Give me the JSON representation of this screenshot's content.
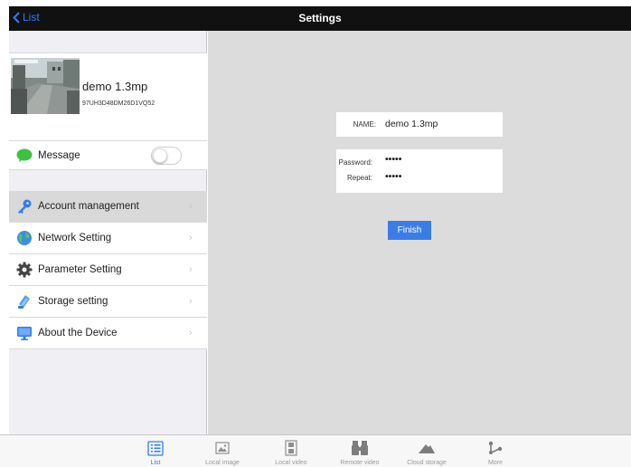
{
  "navbar": {
    "back_label": "List",
    "title": "Settings"
  },
  "device": {
    "name": "demo 1.3mp",
    "id": "97UH3D48DM26D1VQ52"
  },
  "message": {
    "label": "Message",
    "enabled": false
  },
  "menu": {
    "items": [
      {
        "label": "Account management",
        "icon": "key-icon",
        "selected": true
      },
      {
        "label": "Network Setting",
        "icon": "globe-icon",
        "selected": false
      },
      {
        "label": "Parameter Setting",
        "icon": "gear-icon",
        "selected": false
      },
      {
        "label": "Storage setting",
        "icon": "storage-icon",
        "selected": false
      },
      {
        "label": "About the Device",
        "icon": "monitor-icon",
        "selected": false
      }
    ]
  },
  "account_form": {
    "name_label": "NAME:",
    "name_value": "demo 1.3mp",
    "password_label": "Password:",
    "password_value": "•••••",
    "repeat_label": "Repeat:",
    "repeat_value": "•••••",
    "finish_label": "Finish"
  },
  "tabbar": {
    "tabs": [
      {
        "label": "List",
        "icon": "list-icon",
        "active": true
      },
      {
        "label": "Local image",
        "icon": "image-icon",
        "active": false
      },
      {
        "label": "Local video",
        "icon": "film-icon",
        "active": false
      },
      {
        "label": "Remote video",
        "icon": "binoculars-icon",
        "active": false
      },
      {
        "label": "Cloud storage",
        "icon": "cloud-icon",
        "active": false
      },
      {
        "label": "More",
        "icon": "more-icon",
        "active": false
      }
    ]
  },
  "colors": {
    "accent": "#2f7cf6",
    "finish_button": "#3b7de6",
    "navbar": "#111111",
    "selected_row": "#d9d9d9",
    "main_bg": "#dcdcdc"
  }
}
